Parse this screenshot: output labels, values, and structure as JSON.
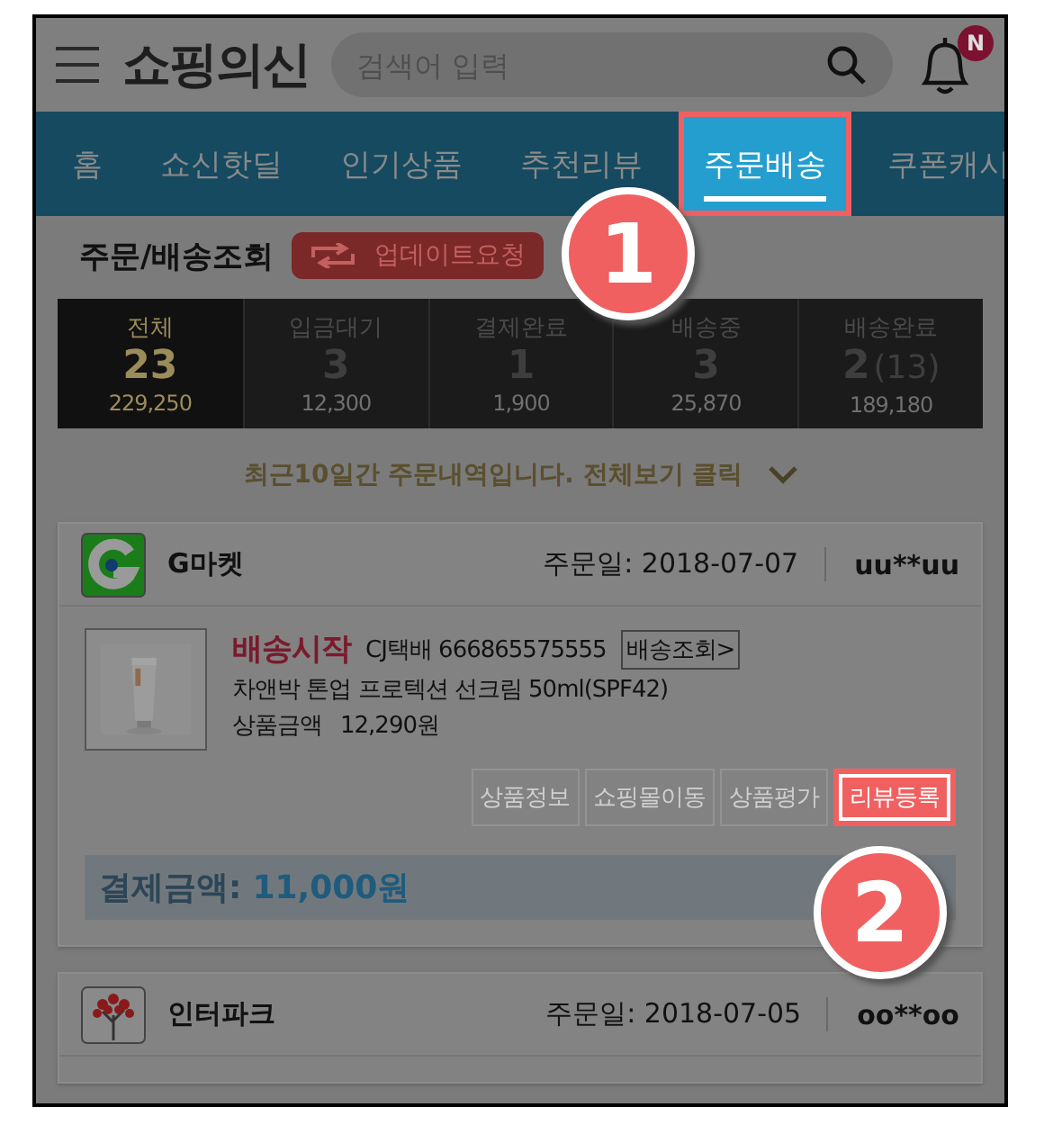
{
  "header": {
    "logo": "쇼핑의신",
    "search": {
      "placeholder": "검색어 입력"
    },
    "notification_badge": "N"
  },
  "tabs": [
    {
      "label": "홈",
      "selected": false
    },
    {
      "label": "쇼신핫딜",
      "selected": false
    },
    {
      "label": "인기상품",
      "selected": false
    },
    {
      "label": "추천리뷰",
      "selected": false
    },
    {
      "label": "주문배송",
      "selected": true
    },
    {
      "label": "쿠폰캐시",
      "selected": false
    }
  ],
  "section": {
    "title": "주문/배송조회",
    "update_button": "업데이트요청"
  },
  "stats": [
    {
      "label": "전체",
      "count": "23",
      "amount": "229,250",
      "selected": true
    },
    {
      "label": "입금대기",
      "count": "3",
      "amount": "12,300",
      "selected": false
    },
    {
      "label": "결제완료",
      "count": "1",
      "amount": "1,900",
      "selected": false
    },
    {
      "label": "배송중",
      "count": "3",
      "amount": "25,870",
      "selected": false
    },
    {
      "label": "배송완료",
      "count": "2",
      "extra": "(13)",
      "amount": "189,180",
      "selected": false
    }
  ],
  "notice": "최근10일간 주문내역입니다. 전체보기 클릭",
  "orders": [
    {
      "mall": "G마켓",
      "kind": "g",
      "date": "주문일: 2018-07-07",
      "user": "uu**uu",
      "status": "배송시작",
      "courier": "CJ택배 666865575555",
      "track_button": "배송조회>",
      "product": "차앤박 톤업 프로텍션 선크림 50ml(SPF42)",
      "price_label": "상품금액",
      "price": "12,290원",
      "image": {
        "kind": "picture"
      },
      "actions": [
        {
          "label": "상품정보",
          "highlighted": false
        },
        {
          "label": "쇼핑몰이동",
          "highlighted": false
        },
        {
          "label": "상품평가",
          "highlighted": false
        },
        {
          "label": "리뷰등록",
          "highlighted": true
        }
      ],
      "payment_label": "결제금액:",
      "payment": "11,000원"
    },
    {
      "mall": "인터파크",
      "kind": "tree",
      "date": "주문일: 2018-07-05",
      "user": "oo**oo"
    }
  ],
  "callouts": [
    "1",
    "2"
  ]
}
